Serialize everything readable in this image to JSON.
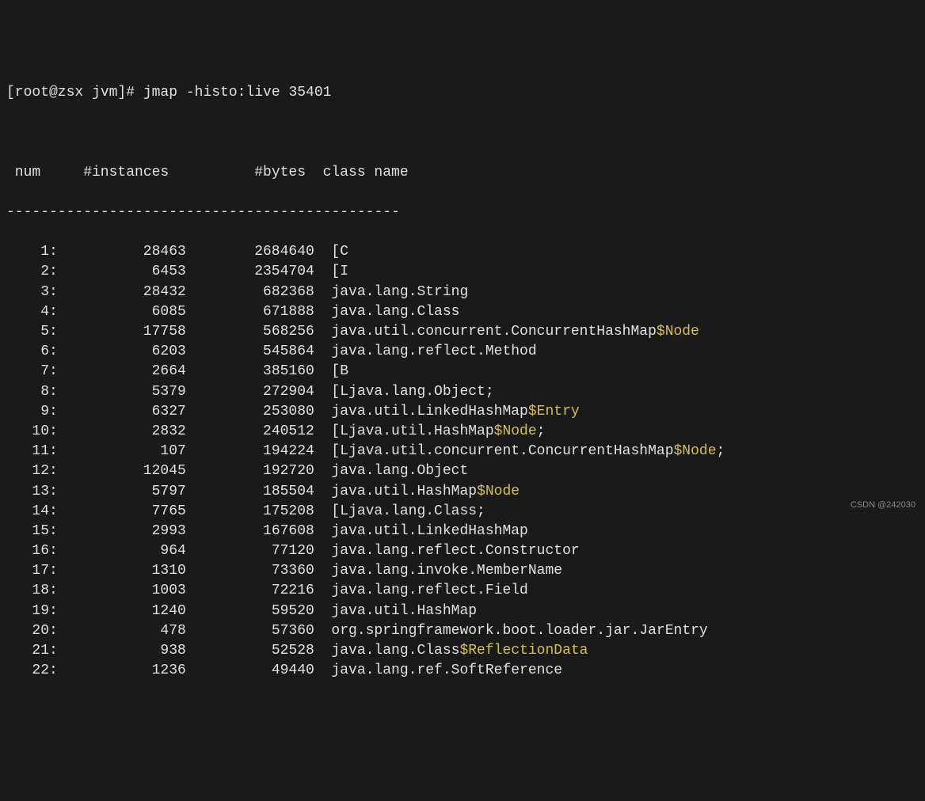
{
  "prompt": "[root@zsx jvm]# jmap -histo:live 35401",
  "headers": {
    "num": "num",
    "instances": "#instances",
    "bytes": "#bytes",
    "className": "class name"
  },
  "separator": "----------------------------------------------",
  "rows": [
    {
      "num": "1:",
      "instances": "28463",
      "bytes": "2684640",
      "className": "[C",
      "highlight": null
    },
    {
      "num": "2:",
      "instances": "6453",
      "bytes": "2354704",
      "className": "[I",
      "highlight": null
    },
    {
      "num": "3:",
      "instances": "28432",
      "bytes": "682368",
      "className": "java.lang.String",
      "highlight": null
    },
    {
      "num": "4:",
      "instances": "6085",
      "bytes": "671888",
      "className": "java.lang.Class",
      "highlight": null
    },
    {
      "num": "5:",
      "instances": "17758",
      "bytes": "568256",
      "className": "java.util.concurrent.ConcurrentHashMap",
      "highlight": "$Node"
    },
    {
      "num": "6:",
      "instances": "6203",
      "bytes": "545864",
      "className": "java.lang.reflect.Method",
      "highlight": null
    },
    {
      "num": "7:",
      "instances": "2664",
      "bytes": "385160",
      "className": "[B",
      "highlight": null
    },
    {
      "num": "8:",
      "instances": "5379",
      "bytes": "272904",
      "className": "[Ljava.lang.Object;",
      "highlight": null
    },
    {
      "num": "9:",
      "instances": "6327",
      "bytes": "253080",
      "className": "java.util.LinkedHashMap",
      "highlight": "$Entry"
    },
    {
      "num": "10:",
      "instances": "2832",
      "bytes": "240512",
      "className": "[Ljava.util.HashMap",
      "highlight": "$Node",
      "suffix": ";"
    },
    {
      "num": "11:",
      "instances": "107",
      "bytes": "194224",
      "className": "[Ljava.util.concurrent.ConcurrentHashMap",
      "highlight": "$Node",
      "suffix": ";"
    },
    {
      "num": "12:",
      "instances": "12045",
      "bytes": "192720",
      "className": "java.lang.Object",
      "highlight": null
    },
    {
      "num": "13:",
      "instances": "5797",
      "bytes": "185504",
      "className": "java.util.HashMap",
      "highlight": "$Node"
    },
    {
      "num": "14:",
      "instances": "7765",
      "bytes": "175208",
      "className": "[Ljava.lang.Class;",
      "highlight": null
    },
    {
      "num": "15:",
      "instances": "2993",
      "bytes": "167608",
      "className": "java.util.LinkedHashMap",
      "highlight": null
    },
    {
      "num": "16:",
      "instances": "964",
      "bytes": "77120",
      "className": "java.lang.reflect.Constructor",
      "highlight": null
    },
    {
      "num": "17:",
      "instances": "1310",
      "bytes": "73360",
      "className": "java.lang.invoke.MemberName",
      "highlight": null
    },
    {
      "num": "18:",
      "instances": "1003",
      "bytes": "72216",
      "className": "java.lang.reflect.Field",
      "highlight": null
    },
    {
      "num": "19:",
      "instances": "1240",
      "bytes": "59520",
      "className": "java.util.HashMap",
      "highlight": null
    },
    {
      "num": "20:",
      "instances": "478",
      "bytes": "57360",
      "className": "org.springframework.boot.loader.jar.JarEntry",
      "highlight": null
    },
    {
      "num": "21:",
      "instances": "938",
      "bytes": "52528",
      "className": "java.lang.Class",
      "highlight": "$ReflectionData"
    },
    {
      "num": "22:",
      "instances": "1236",
      "bytes": "49440",
      "className": "java.lang.ref.SoftReference",
      "highlight": null
    }
  ],
  "watermark": "CSDN @242030"
}
